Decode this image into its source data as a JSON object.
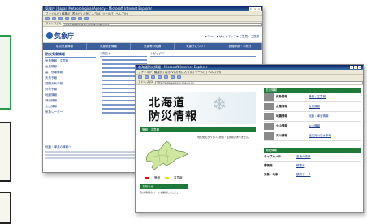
{
  "left_boxes": [
    "",
    "",
    ""
  ],
  "back_window": {
    "title": "気象庁 | Japan Meteorological Agency - Microsoft Internet Explorer",
    "menu": "ファイル(F)  編集(E)  表示(V)  お気に入り(A)  ツール(T)  ヘルプ(H)",
    "address_label": "アドレス(D)",
    "address": "http://www.jma.go.jp/jma/index.html",
    "logo": "気象庁",
    "header_links": "▶ホーム  ▶サイトマップ  ▶ご意見・ご感想",
    "nav": [
      "防災気象情報",
      "気象統計情報",
      "気象等の知識",
      "気象庁について",
      "各種申請・手続き"
    ],
    "left_heading": "防災気象情報",
    "left_items": [
      "気象警報・注意報",
      "台風情報",
      "高・低潮情報",
      "天気予報",
      "週間天気予報",
      "分布予報",
      "地震情報",
      "津波情報",
      "火山情報",
      "気象レーダー"
    ],
    "bottom_link": "地震・津波の情報へ",
    "mid_heading": "お知らせ",
    "right_heading": "トピックス"
  },
  "front_window": {
    "title": "北海道防災情報 - Microsoft Internet Explorer",
    "menu": "ファイル(F)  編集(E)  表示(V)  お気に入り(A)  ツール(T)  ヘルプ(H)",
    "address_label": "アドレス(D)",
    "address": "http://www.sapporo-jma.go.jp/",
    "banner_title_line1": "北海道",
    "banner_title_line2": "防災情報",
    "left_panel_head": "警報・注意報",
    "left_panel_text": "現在発表されている警報・注意報はありません。",
    "legend_warning": "警報",
    "legend_advisory": "注意報",
    "news_head": "お知らせ",
    "news_text": "防災情報のページを開設しました。",
    "right_head": "防災情報",
    "right_rows": [
      {
        "label": "気象警報",
        "link": "警報・注意報"
      },
      {
        "label": "台風情報",
        "link": "台風情報"
      },
      {
        "label": "地震情報",
        "link": "地震・津波情報"
      },
      {
        "label": "火山情報",
        "link": "火山情報"
      },
      {
        "label": "河川情報",
        "link": "指定河川洪水予報"
      }
    ],
    "right_head2": "関連情報",
    "right_rows2": [
      {
        "label": "ライブカメラ",
        "link": "各地の映像"
      },
      {
        "label": "雪情報",
        "link": "積雪深"
      },
      {
        "label": "気象・地象",
        "link": "観測データ"
      }
    ],
    "colors": {
      "warning": "#e60000",
      "advisory": "#f5dc00",
      "panel_green": "#1f7a3a",
      "nav_blue": "#3c5f9c"
    }
  }
}
